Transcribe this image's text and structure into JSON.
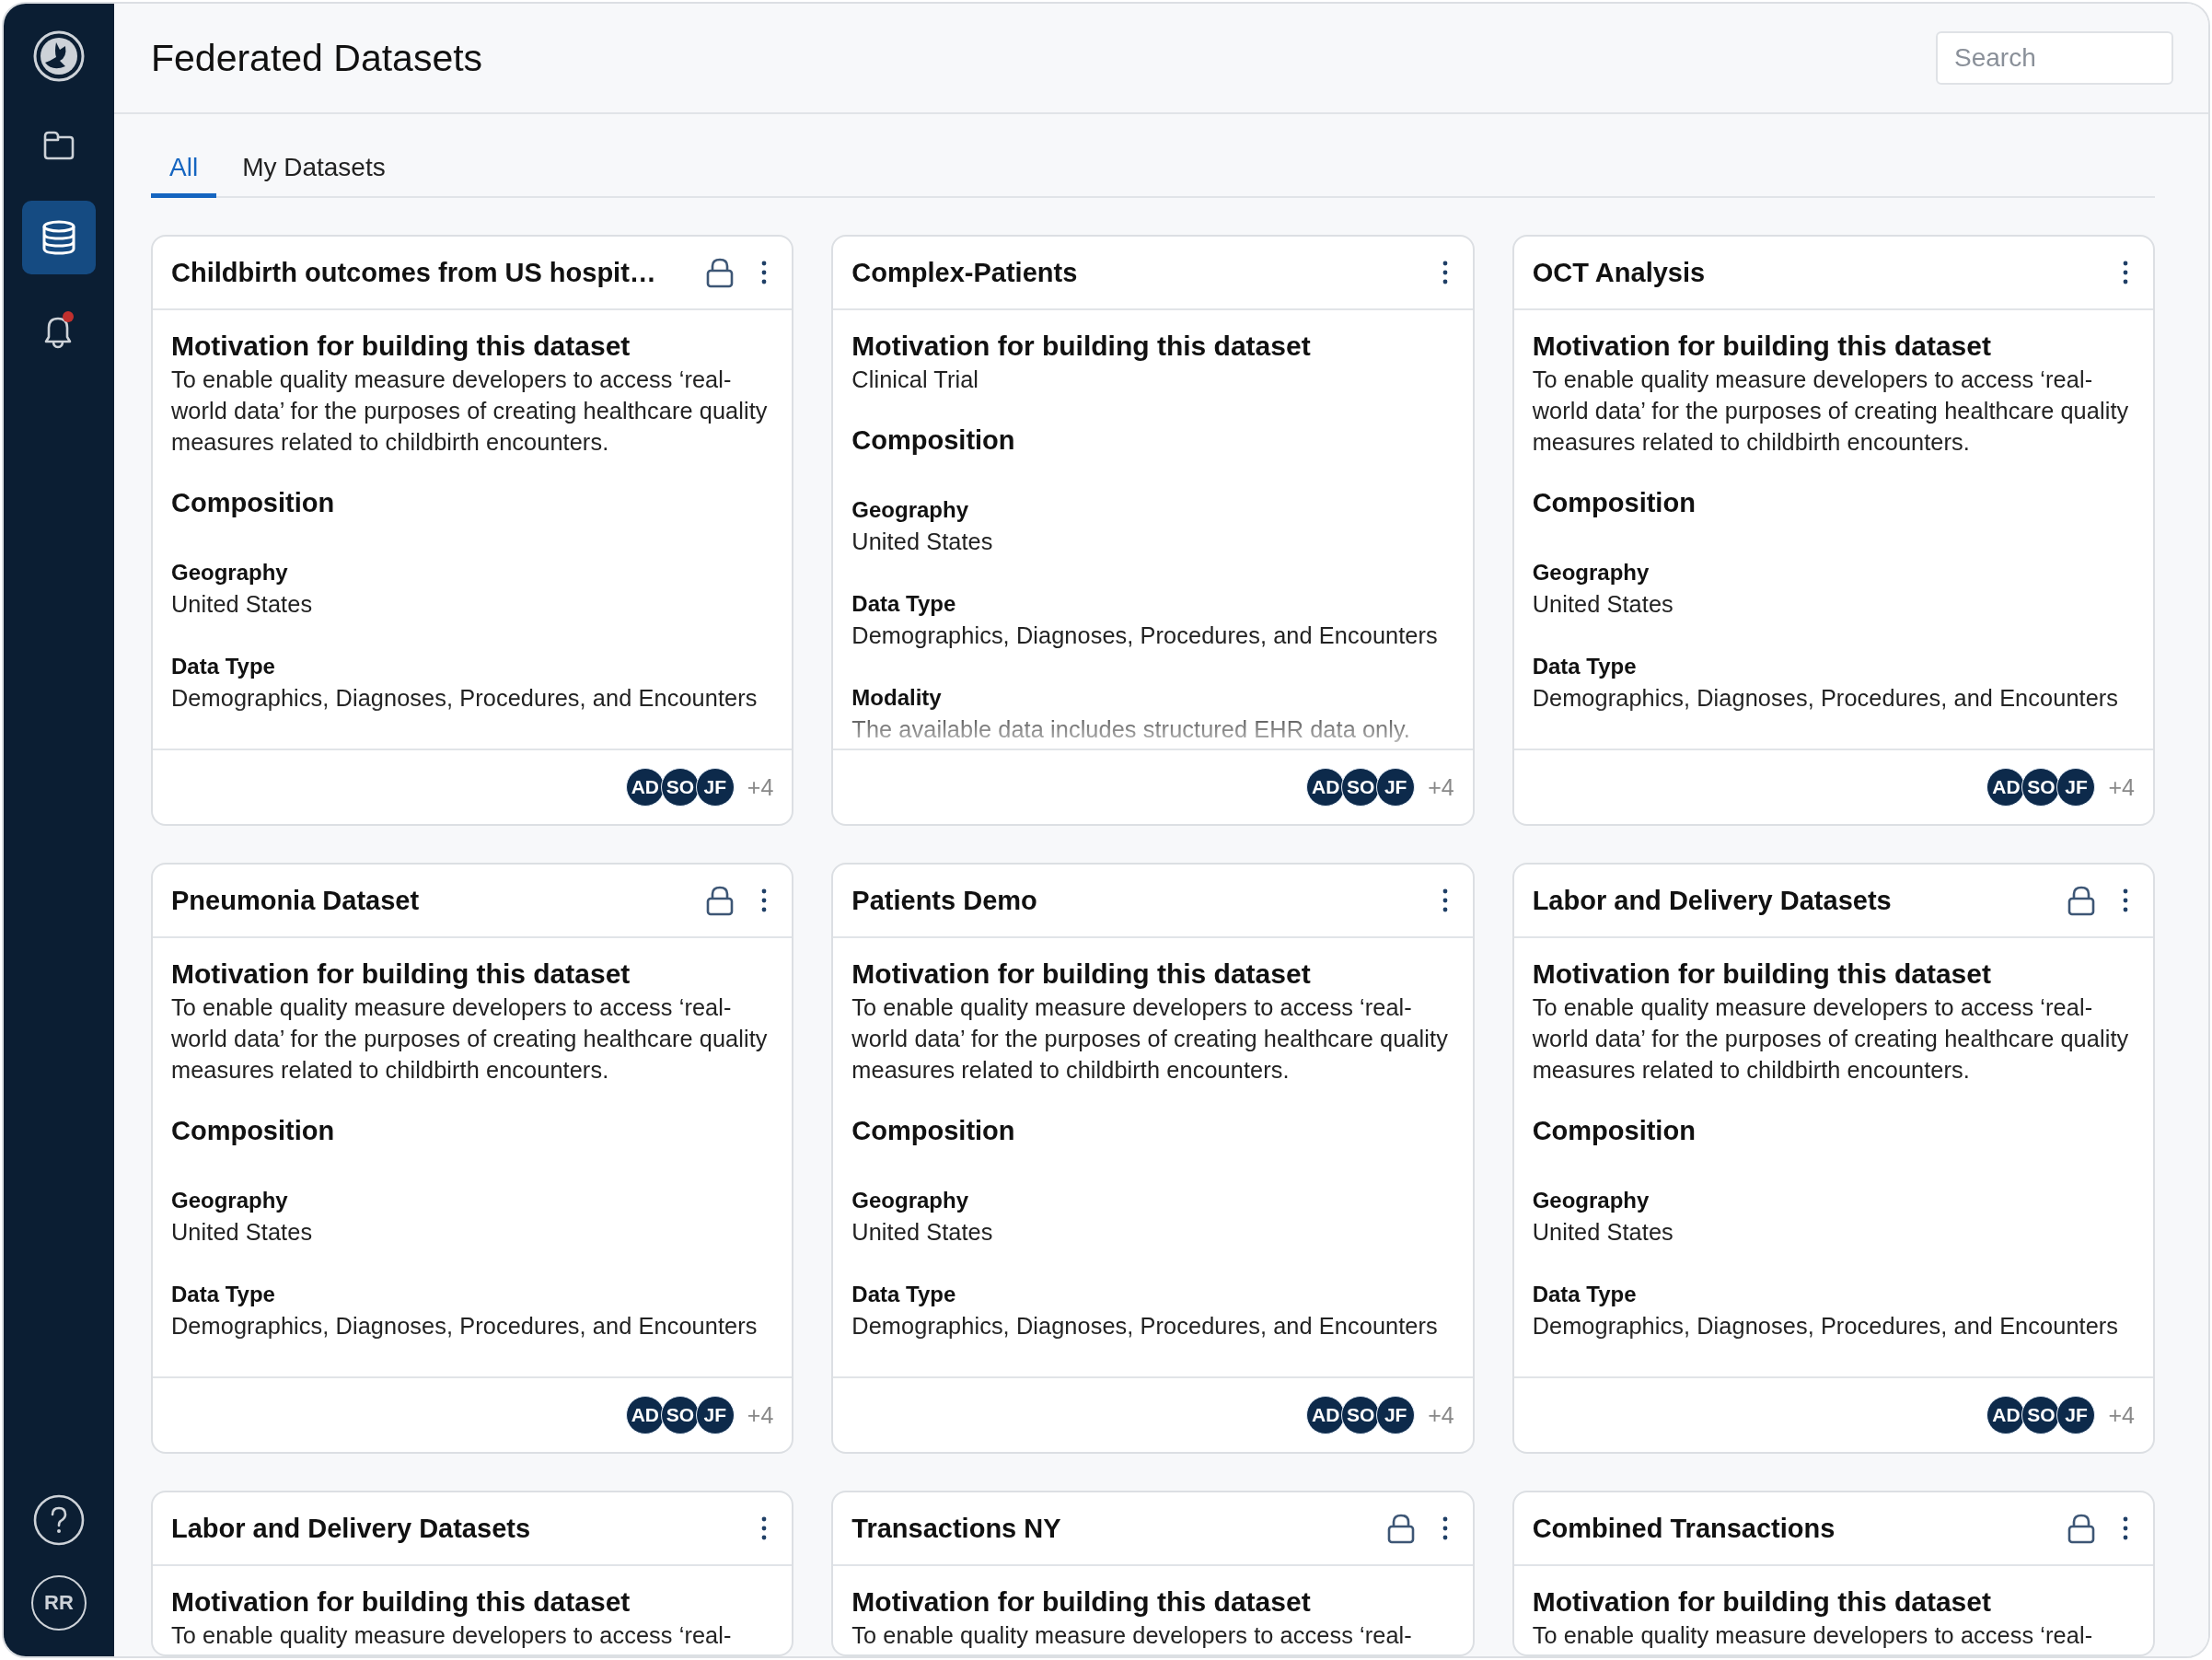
{
  "sidebar": {
    "items": [
      {
        "kind": "folder",
        "selected": false
      },
      {
        "kind": "database",
        "selected": true
      },
      {
        "kind": "bell",
        "selected": false,
        "notification": true
      }
    ],
    "bottom": [
      {
        "kind": "help"
      },
      {
        "kind": "avatar",
        "initials": "RR"
      }
    ]
  },
  "header": {
    "title": "Federated Datasets",
    "search": {
      "placeholder": "Search"
    }
  },
  "tabs": [
    {
      "label": "All",
      "selected": true
    },
    {
      "label": "My Datasets",
      "selected": false
    }
  ],
  "cards": [
    {
      "title": "Childbirth outcomes from US hospit…",
      "locked": true,
      "motivation_heading": "Motivation for building this dataset",
      "motivation": "To enable quality measure developers to access ‘real-world data’ for the purposes of creating healthcare quality measures related to childbirth encounters.",
      "composition_heading": "Composition",
      "fields": [
        {
          "label": "Geography",
          "value": "United States"
        },
        {
          "label": "Data Type",
          "value": "Demographics, Diagnoses, Procedures, and Encounters"
        }
      ],
      "members": [
        "AD",
        "SO",
        "JF"
      ],
      "more": "+4"
    },
    {
      "title": "Complex-Patients",
      "locked": false,
      "motivation_heading": "Motivation for building this dataset",
      "motivation": "Clinical Trial",
      "composition_heading": "Composition",
      "fields": [
        {
          "label": "Geography",
          "value": "United States"
        },
        {
          "label": "Data Type",
          "value": "Demographics, Diagnoses, Procedures, and Encounters"
        },
        {
          "label": "Modality",
          "value": "The available data includes structured EHR data only."
        }
      ],
      "members": [
        "AD",
        "SO",
        "JF"
      ],
      "more": "+4"
    },
    {
      "title": "OCT Analysis",
      "locked": false,
      "motivation_heading": "Motivation for building this dataset",
      "motivation": "To enable quality measure developers to access ‘real-world data’ for the purposes of creating healthcare quality measures related to childbirth encounters.",
      "composition_heading": "Composition",
      "fields": [
        {
          "label": "Geography",
          "value": "United States"
        },
        {
          "label": "Data Type",
          "value": "Demographics, Diagnoses, Procedures, and Encounters"
        }
      ],
      "members": [
        "AD",
        "SO",
        "JF"
      ],
      "more": "+4"
    },
    {
      "title": "Pneumonia Dataset",
      "locked": true,
      "motivation_heading": "Motivation for building this dataset",
      "motivation": "To enable quality measure developers to access ‘real-world data’ for the purposes of creating healthcare quality measures related to childbirth encounters.",
      "composition_heading": "Composition",
      "fields": [
        {
          "label": "Geography",
          "value": "United States"
        },
        {
          "label": "Data Type",
          "value": "Demographics, Diagnoses, Procedures, and Encounters"
        }
      ],
      "members": [
        "AD",
        "SO",
        "JF"
      ],
      "more": "+4"
    },
    {
      "title": "Patients Demo",
      "locked": false,
      "motivation_heading": "Motivation for building this dataset",
      "motivation": "To enable quality measure developers to access ‘real-world data’ for the purposes of creating healthcare quality measures related to childbirth encounters.",
      "composition_heading": "Composition",
      "fields": [
        {
          "label": "Geography",
          "value": "United States"
        },
        {
          "label": "Data Type",
          "value": "Demographics, Diagnoses, Procedures, and Encounters"
        }
      ],
      "members": [
        "AD",
        "SO",
        "JF"
      ],
      "more": "+4"
    },
    {
      "title": "Labor and Delivery Datasets",
      "locked": true,
      "motivation_heading": "Motivation for building this dataset",
      "motivation": "To enable quality measure developers to access ‘real-world data’ for the purposes of creating healthcare quality measures related to childbirth encounters.",
      "composition_heading": "Composition",
      "fields": [
        {
          "label": "Geography",
          "value": "United States"
        },
        {
          "label": "Data Type",
          "value": "Demographics, Diagnoses, Procedures, and Encounters"
        }
      ],
      "members": [
        "AD",
        "SO",
        "JF"
      ],
      "more": "+4"
    },
    {
      "title": "Labor and Delivery Datasets",
      "locked": false,
      "motivation_heading": "Motivation for building this dataset",
      "motivation": "To enable quality measure developers to access ‘real-"
    },
    {
      "title": "Transactions NY",
      "locked": true,
      "motivation_heading": "Motivation for building this dataset",
      "motivation": "To enable quality measure developers to access ‘real-"
    },
    {
      "title": "Combined Transactions",
      "locked": true,
      "motivation_heading": "Motivation for building this dataset",
      "motivation": "To enable quality measure developers to access ‘real-"
    }
  ]
}
